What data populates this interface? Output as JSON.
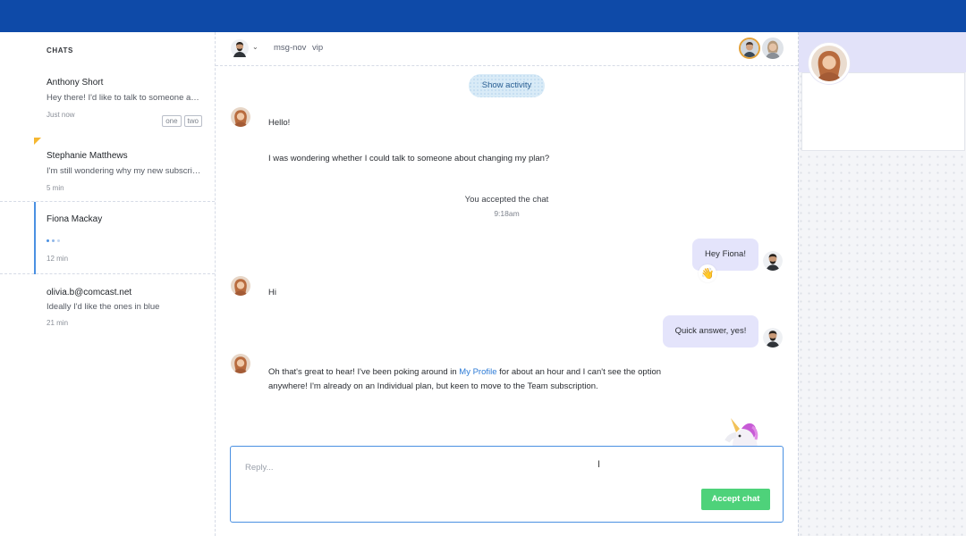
{
  "sidebar": {
    "header": "CHATS",
    "chats": [
      {
        "name": "Anthony Short",
        "preview": "Hey there! I'd like to talk to someone abo...",
        "time": "Just now",
        "tags": [
          "one",
          "two"
        ]
      },
      {
        "name": "Stephanie Matthews",
        "preview": "I'm still wondering why my new subscrip...",
        "time": "5 min"
      },
      {
        "name": "Fiona Mackay",
        "preview": "",
        "time": "12 min"
      },
      {
        "name": "olivia.b@comcast.net",
        "preview": "Ideally I'd like the ones in blue",
        "time": "21 min"
      }
    ]
  },
  "header": {
    "tags": [
      "msg-nov",
      "vip"
    ]
  },
  "conversation": {
    "show_activity": "Show activity",
    "messages": {
      "m1": "Hello!",
      "m2": "I was wondering whether I could talk to someone about changing my plan?",
      "m3": "Hi",
      "m4_before": "Oh that's great to hear! I've been poking around in ",
      "m4_link": "My Profile",
      "m4_after": " for about an hour and I can't see the option",
      "m4_line2": "anywhere! I'm already on an Individual plan, but keen to move to the Team subscription."
    },
    "system": {
      "text": "You accepted the chat",
      "time": "9:18am"
    },
    "agent_bubbles": [
      "Hey Fiona!",
      "Quick answer, yes!"
    ],
    "reaction": "👋"
  },
  "composer": {
    "placeholder": "Reply...",
    "accept_label": "Accept chat"
  },
  "colors": {
    "topbar": "#0e4aa8",
    "accent": "#4a90e2",
    "accept": "#4ed27a",
    "bubble": "#e4e4fb",
    "flag": "#f5b731"
  }
}
